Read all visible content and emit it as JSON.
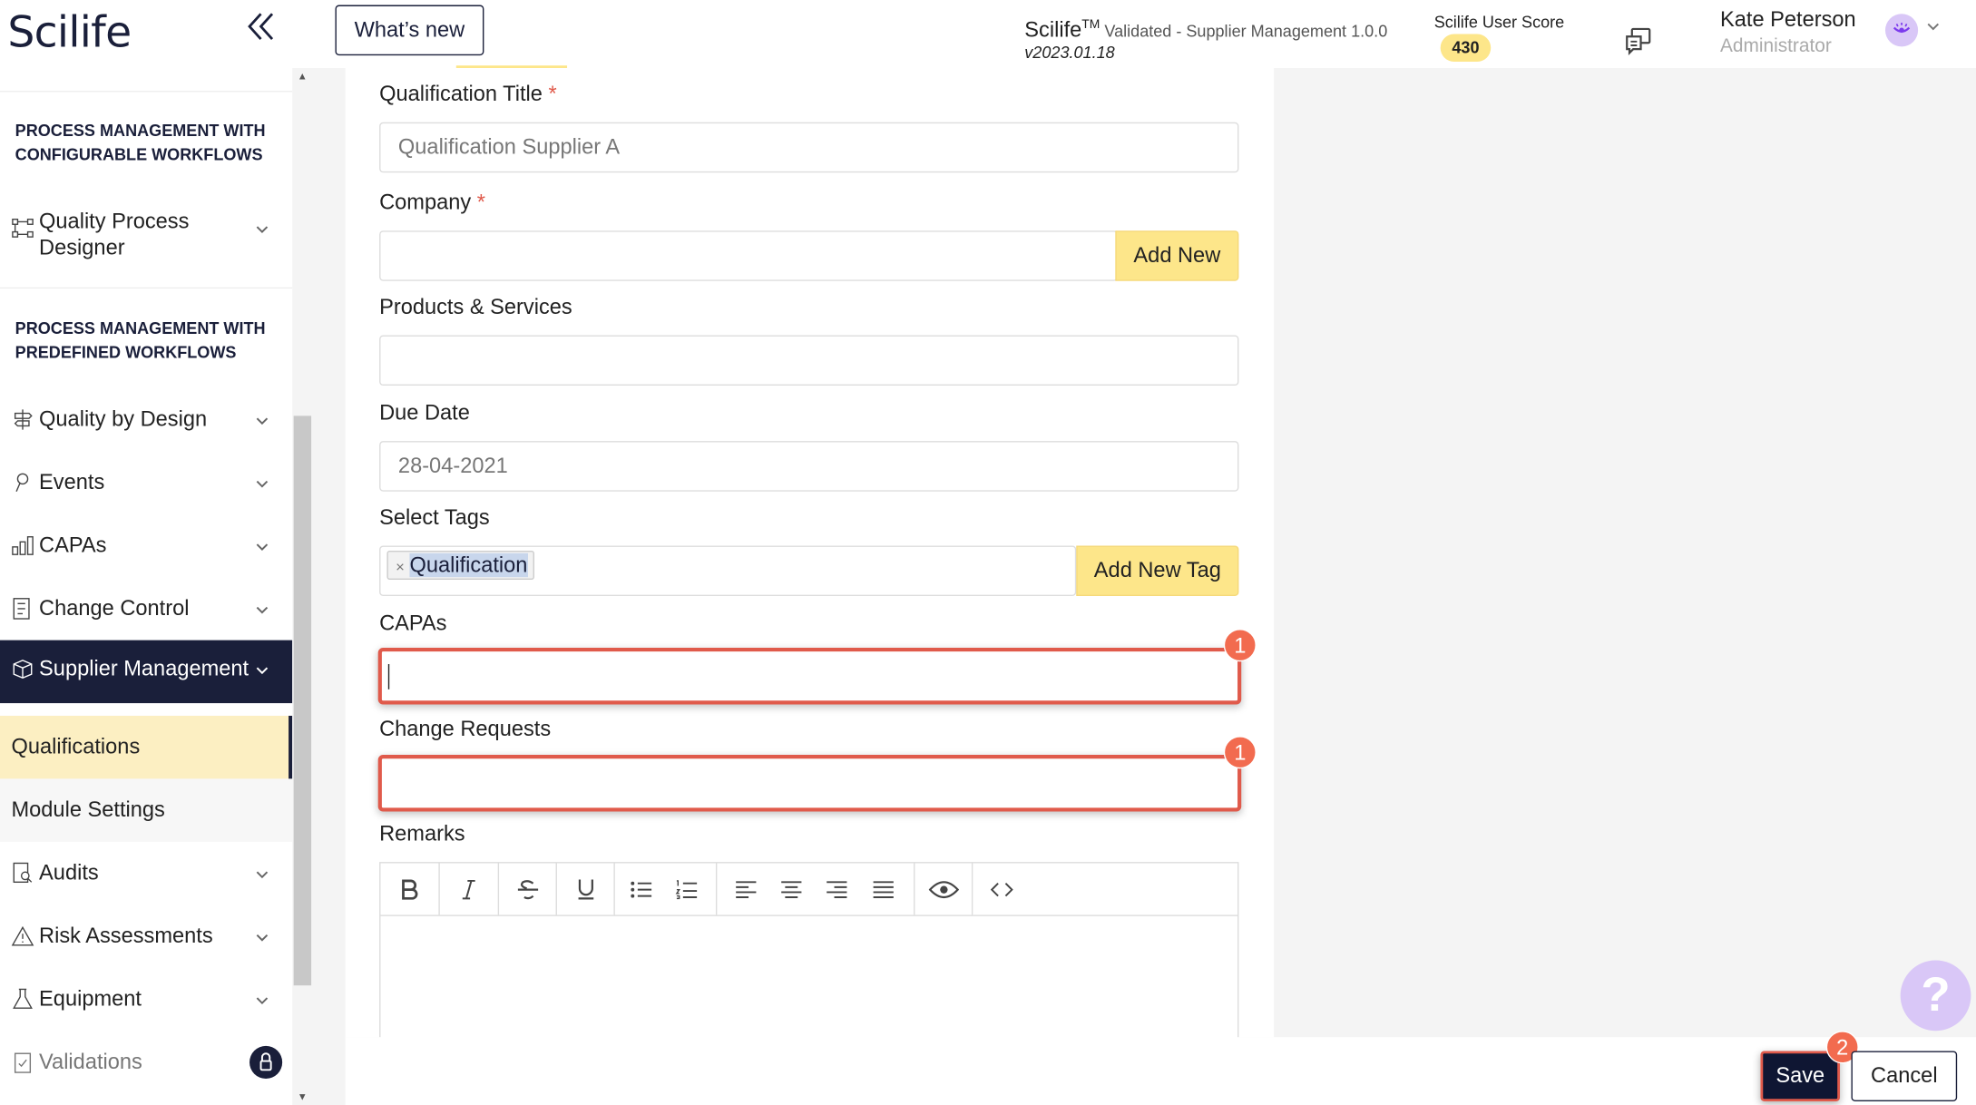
{
  "header": {
    "logo": "Scilife",
    "whats_new": "What’s new",
    "app_name": "Scilife",
    "tm": "TM",
    "app_sub": " Validated - Supplier Management 1.0.0",
    "version": "v2023.01.18",
    "score_label": "Scilife User Score",
    "score_value": "430",
    "user_name": "Kate Peterson",
    "user_role": "Administrator"
  },
  "sidebar": {
    "section_configurable": "PROCESS MANAGEMENT WITH CONFIGURABLE WORKFLOWS",
    "section_predefined": "PROCESS MANAGEMENT WITH PREDEFINED WORKFLOWS",
    "items": {
      "quality_process_designer": "Quality Process Designer",
      "quality_by_design": "Quality by Design",
      "events": "Events",
      "capas": "CAPAs",
      "change_control": "Change Control",
      "supplier_management": "Supplier Management",
      "qualifications": "Qualifications",
      "module_settings": "Module Settings",
      "audits": "Audits",
      "risk_assessments": "Risk Assessments",
      "equipment": "Equipment",
      "validations": "Validations"
    }
  },
  "form": {
    "qualification_title_label": "Qualification Title",
    "qualification_title_placeholder": "Qualification Supplier A",
    "company_label": "Company",
    "add_new": "Add New",
    "products_label": "Products & Services",
    "due_date_label": "Due Date",
    "due_date_value": "28-04-2021",
    "select_tags_label": "Select Tags",
    "tag_value": "Qualification",
    "add_new_tag": "Add New Tag",
    "capas_label": "CAPAs",
    "change_requests_label": "Change Requests",
    "remarks_label": "Remarks",
    "required_mark": "*"
  },
  "annotations": {
    "step_one": "1",
    "step_two": "2",
    "highlight_color": "#e05a4b"
  },
  "footer": {
    "save": "Save",
    "cancel": "Cancel"
  },
  "help": "?"
}
